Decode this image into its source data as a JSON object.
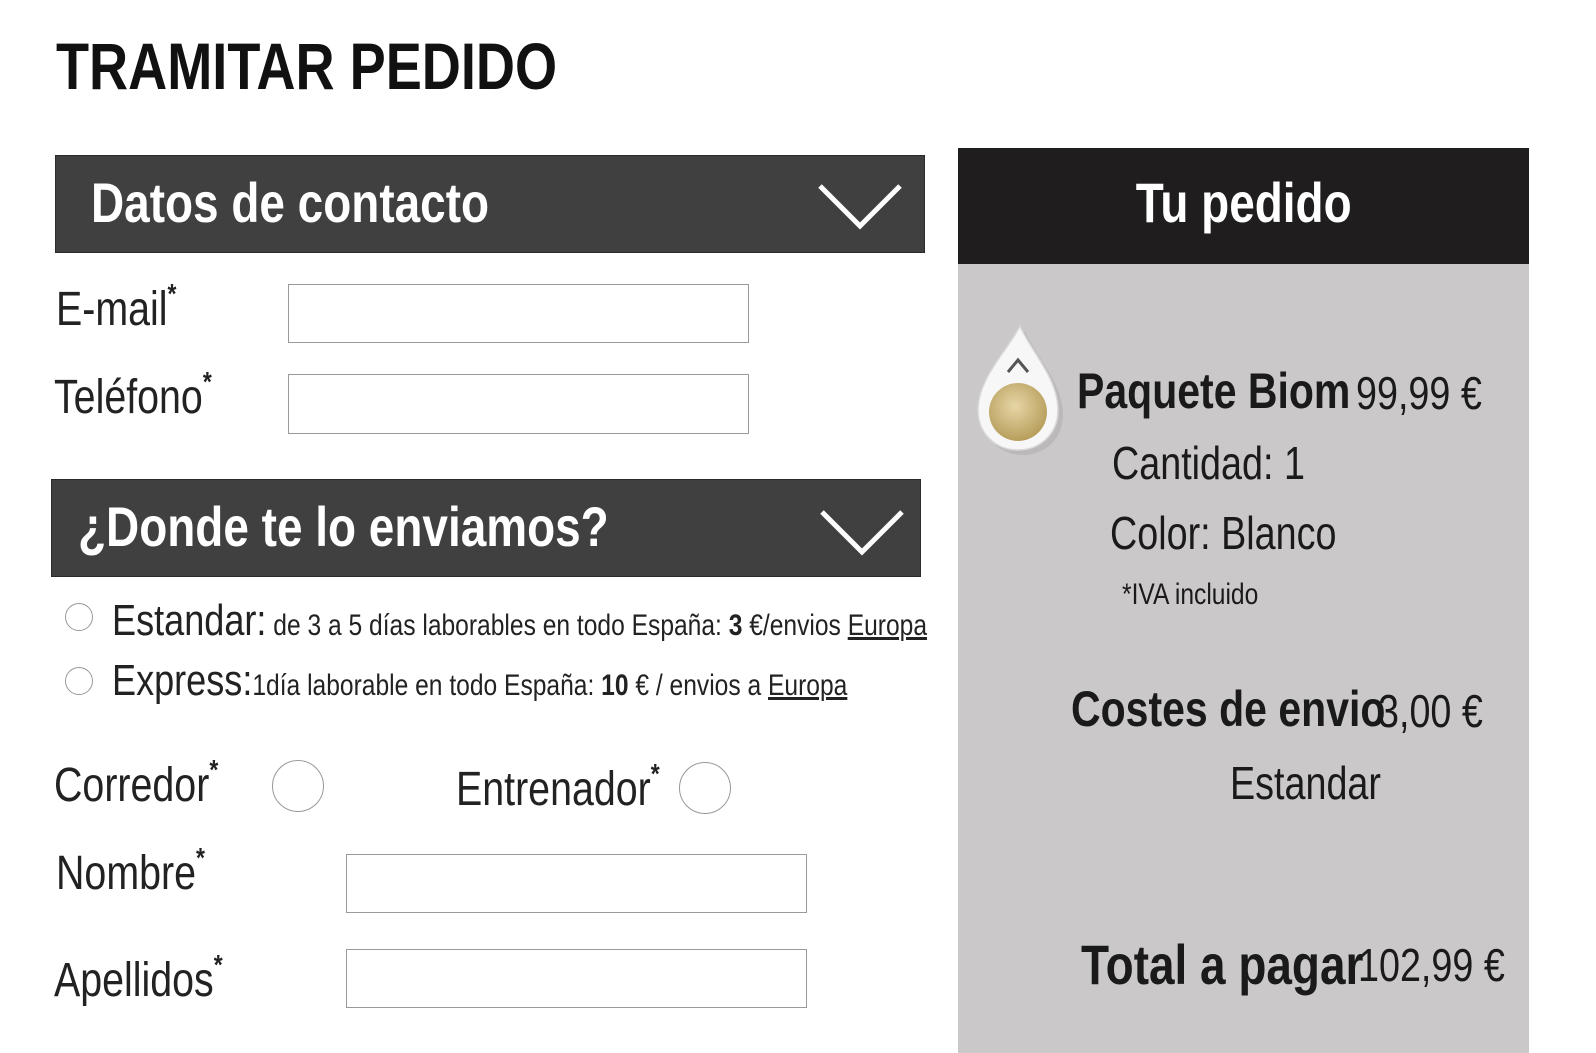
{
  "page": {
    "title": "TRAMITAR PEDIDO"
  },
  "contact": {
    "section_title": "Datos de contacto",
    "email_label": "E-mail",
    "phone_label": "Teléfono",
    "required_mark": "*",
    "email_value": "",
    "phone_value": ""
  },
  "shipping": {
    "section_title": "¿Donde te lo enviamos?",
    "standard": {
      "name": "Estandar:",
      "desc": " de 3 a 5 días laborables en todo España: ",
      "price": "3",
      "currency_sep": " €/envios ",
      "link": "Europa"
    },
    "express": {
      "name": "Express:",
      "desc": "1día laborable en todo España: ",
      "price": "10",
      "currency_sep": " € / envios a ",
      "link": "Europa"
    }
  },
  "profile": {
    "runner_label": "Corredor",
    "coach_label": "Entrenador",
    "name_label": "Nombre",
    "surname_label": "Apellidos",
    "name_value": "",
    "surname_value": ""
  },
  "order": {
    "title": "Tu pedido",
    "product_name": "Paquete Biom",
    "product_price": "99,99 €",
    "quantity": "Cantidad: 1",
    "color": "Color: Blanco",
    "vat_note": "*IVA incluido",
    "shipping_label": "Costes de envio",
    "shipping_price": "3,00 €",
    "shipping_method": "Estandar",
    "total_label": "Total a pagar",
    "total_price": "102,99 €"
  },
  "colors": {
    "bar": "#404040",
    "panel": "#cbc8c9",
    "panel_header": "#1f1d1d",
    "device_gold": "#d4bd82"
  },
  "icons": {
    "collapse": "chevron-down-icon",
    "product": "biom-device-icon"
  }
}
